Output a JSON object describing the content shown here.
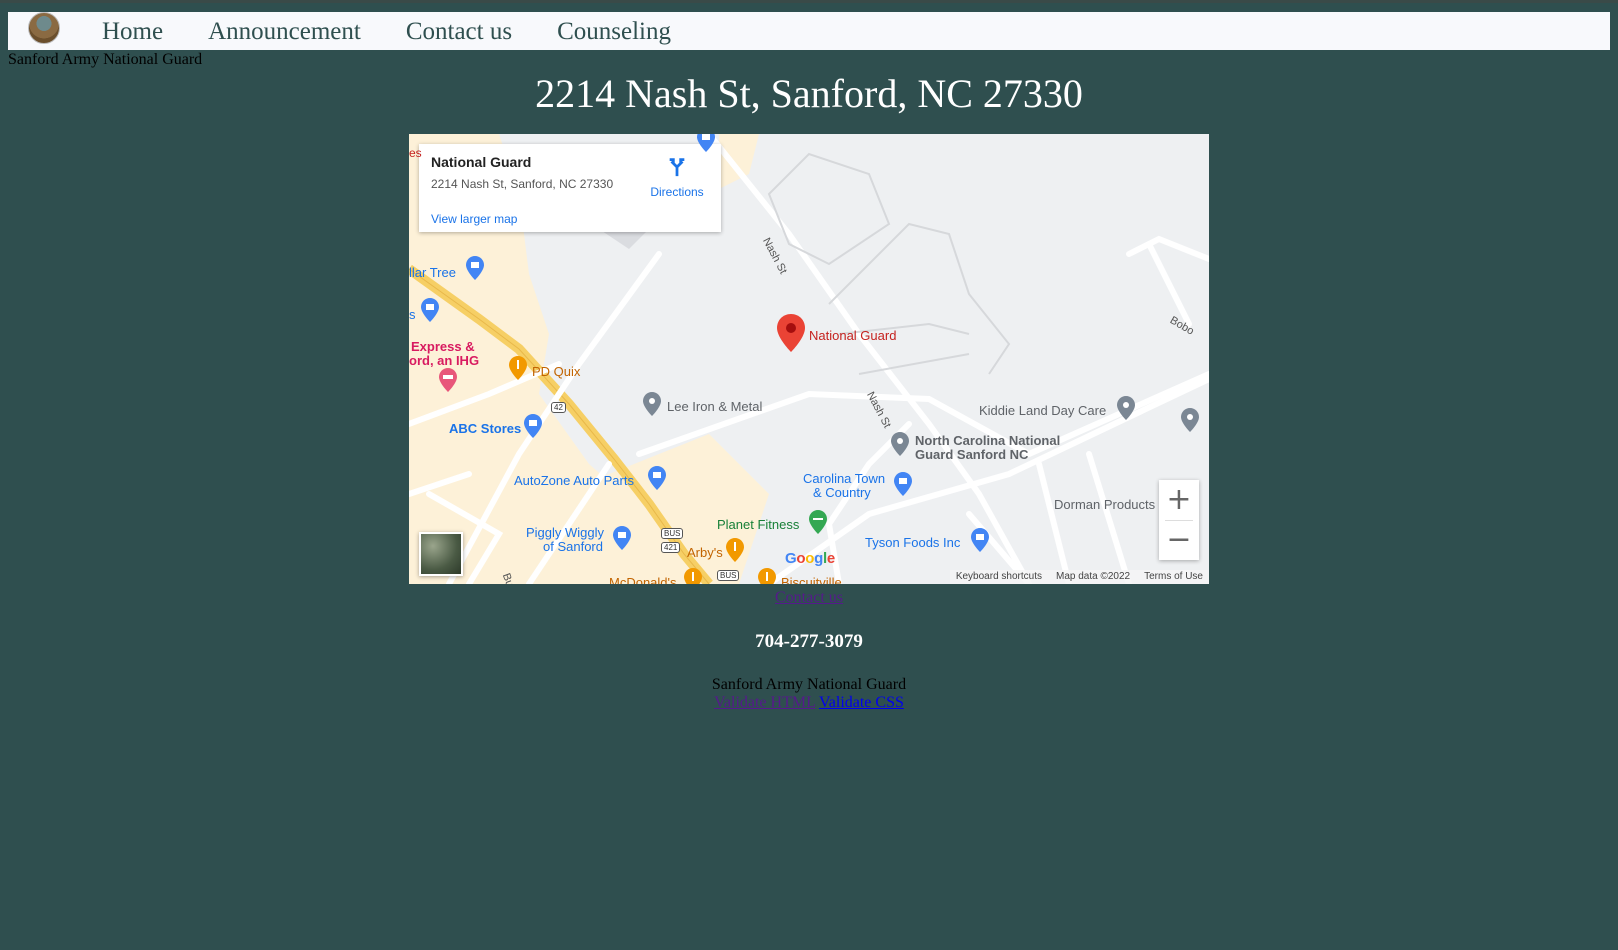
{
  "nav": {
    "items": [
      {
        "label": "Home"
      },
      {
        "label": "Announcement"
      },
      {
        "label": "Contact us"
      },
      {
        "label": "Counseling"
      }
    ]
  },
  "site_label": "Sanford Army National Guard",
  "address_title": "2214 Nash St, Sanford, NC 27330",
  "map": {
    "card": {
      "title": "National Guard",
      "address": "2214 Nash St, Sanford, NC 27330",
      "view_larger": "View larger map",
      "directions": "Directions"
    },
    "marker_label": "National Guard",
    "places": {
      "dollar_tree": "llar Tree",
      "express_1": "Express &",
      "express_2": "ord, an IHG",
      "pd_quix": "PD Quix",
      "lee_iron": "Lee Iron & Metal",
      "abc": "ABC Stores",
      "autozone": "AutoZone Auto Parts",
      "kiddie": "Kiddie Land Day Care",
      "ncng_1": "North Carolina National",
      "ncng_2": "Guard Sanford NC",
      "carolina_town_1": "Carolina Town",
      "carolina_town_2": "& Country",
      "dorman": "Dorman Products",
      "planet_fitness": "Planet Fitness",
      "piggly_1": "Piggly Wiggly",
      "piggly_2": "of Sanford",
      "arbys": "Arby's",
      "tyson": "Tyson Foods Inc",
      "mcdonalds": "McDonald's",
      "biscuitville": "Biscuitville",
      "s_partial": "s",
      "es_partial": "es",
      "bobo": "Bobo"
    },
    "streets": {
      "nash_1": "Nash St",
      "nash_2": "Nash St",
      "bu": "Bu"
    },
    "highways": {
      "h42": "42",
      "bus1": "BUS",
      "h421": "421",
      "bus2": "BUS"
    },
    "google": "Google",
    "zoom_in": "+",
    "zoom_out": "−",
    "attribution": {
      "keyboard": "Keyboard shortcuts",
      "map_data": "Map data ©2022",
      "terms": "Terms of Use"
    }
  },
  "contact_link": "Contact us",
  "phone": "704-277-3079",
  "footer": {
    "name": "Sanford Army National Guard",
    "validate_html": "Validate HTML",
    "validate_css": "Validate CSS"
  },
  "colors": {
    "background": "#2f4f4f",
    "navbar": "#f8f9fc",
    "nav_text": "#2f4f4f",
    "map_marker": "#ea4335"
  }
}
